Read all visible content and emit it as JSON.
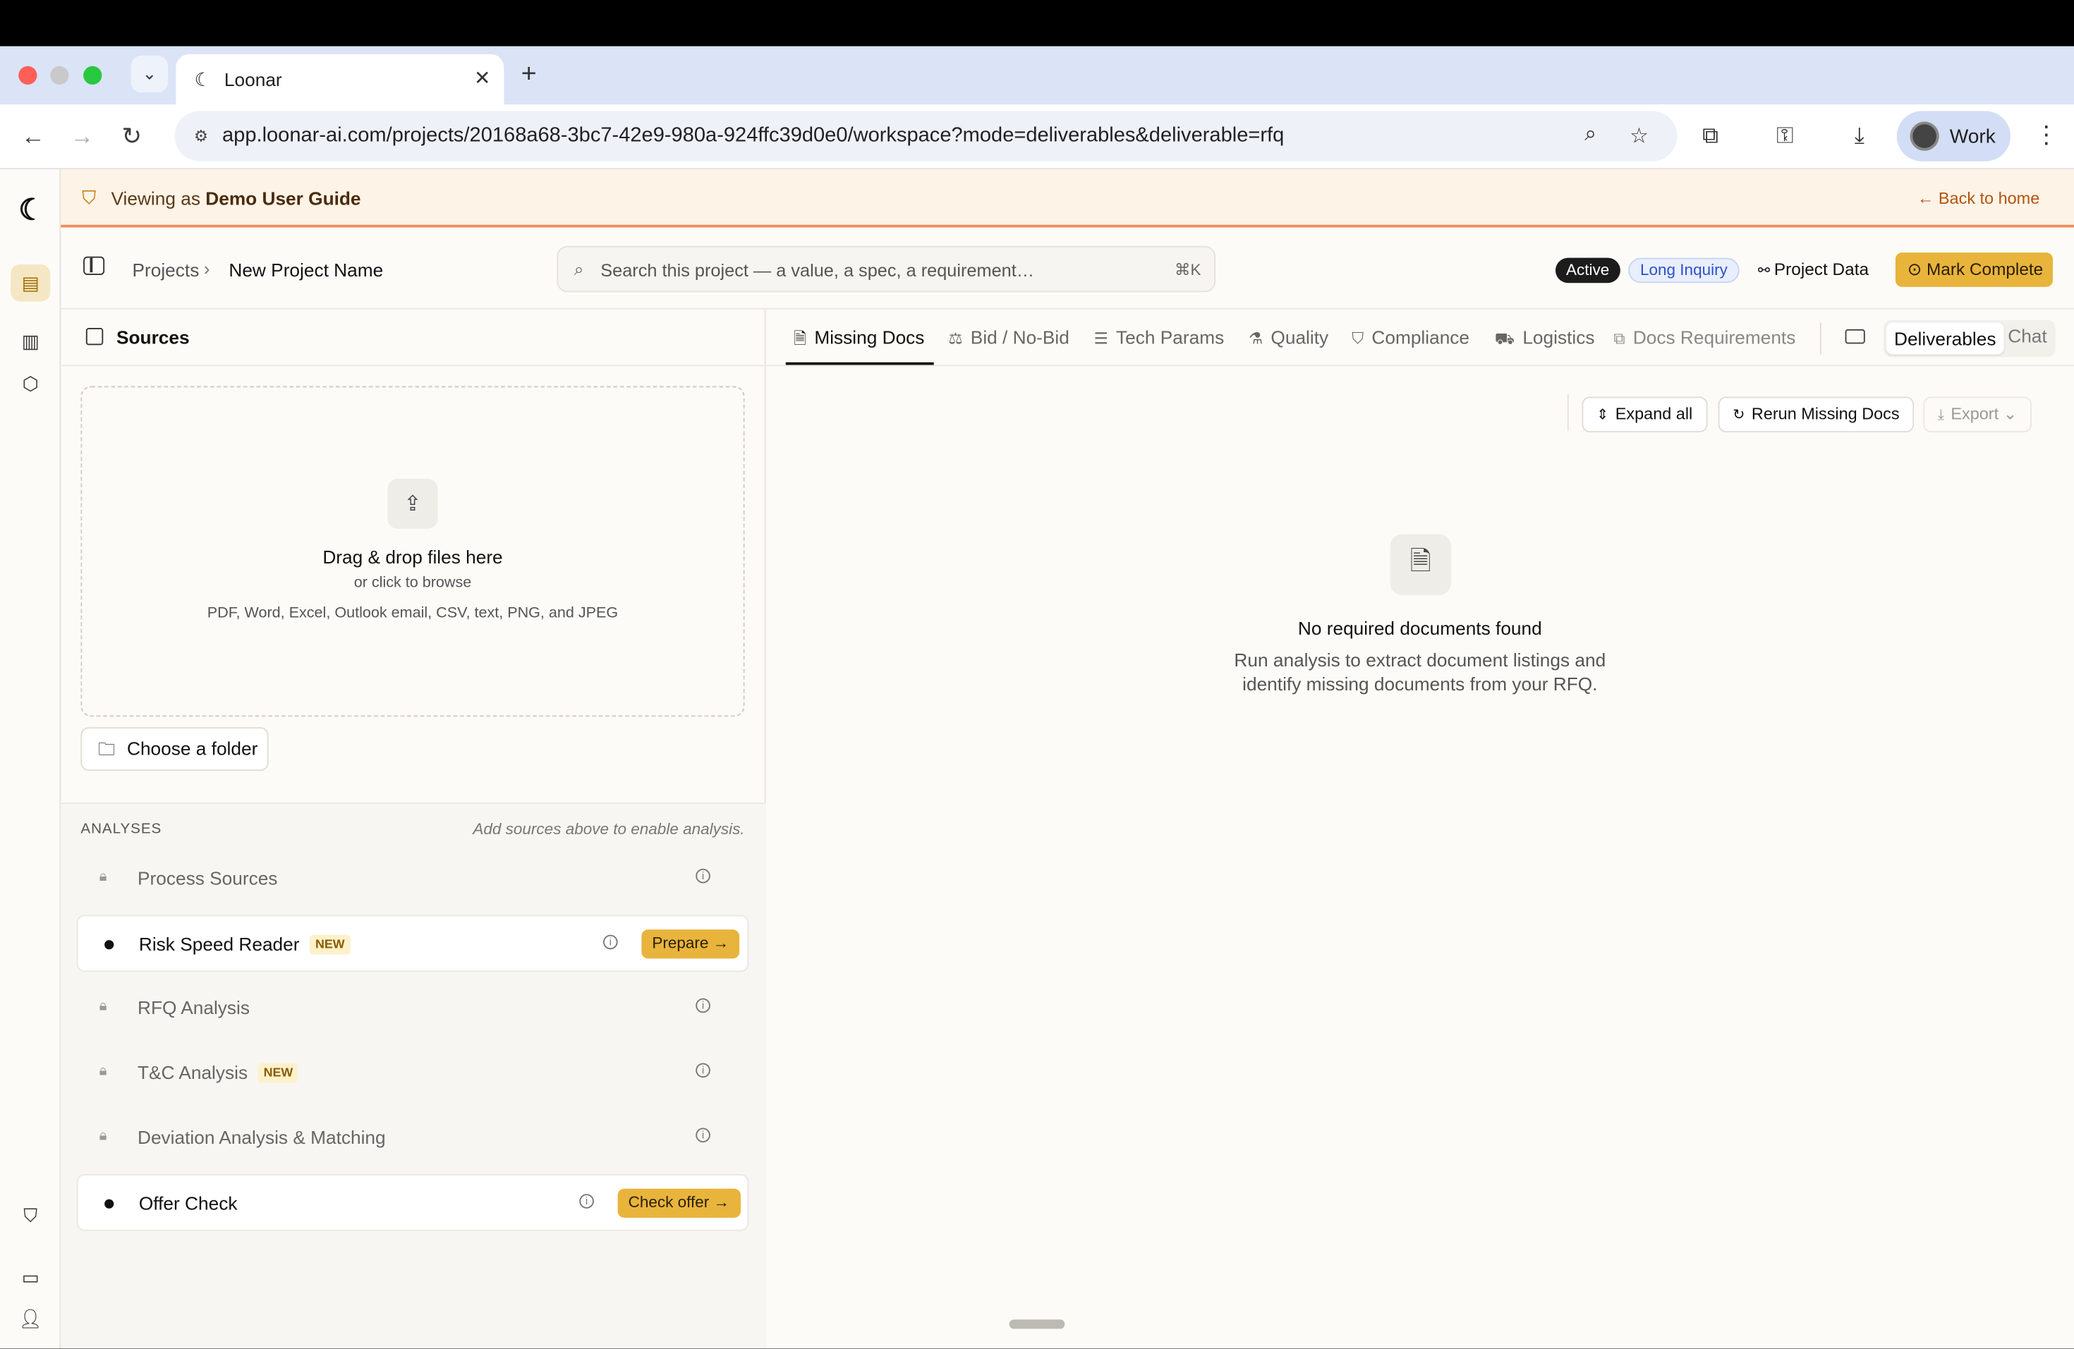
{
  "browser": {
    "tab_title": "Loonar",
    "url": "app.loonar-ai.com/projects/20168a68-3bc7-42e9-980a-924ffc39d0e0/workspace?mode=deliverables&deliverable=rfq",
    "profile_name": "Work",
    "traffic_colors": [
      "#ff5f57",
      "#c9c9c9",
      "#28c840"
    ]
  },
  "banner": {
    "prefix": "Viewing as",
    "user": "Demo User Guide",
    "back_label": "Back to home"
  },
  "header": {
    "breadcrumb_root": "Projects",
    "breadcrumb_current": "New Project Name",
    "search_placeholder": "Search this project — a value, a spec, a requirement…",
    "search_shortcut": "⌘K",
    "status_active": "Active",
    "status_type": "Long Inquiry",
    "project_data_label": "Project Data",
    "mark_complete_label": "Mark Complete"
  },
  "sources": {
    "title": "Sources",
    "drop_title": "Drag & drop files here",
    "drop_sub": "or click to browse",
    "drop_formats": "PDF, Word, Excel, Outlook email, CSV, text, PNG, and JPEG",
    "choose_folder": "Choose a folder"
  },
  "analyses": {
    "heading": "ANALYSES",
    "note": "Add sources above to enable analysis.",
    "items": [
      {
        "name": "Process Sources",
        "locked": true
      },
      {
        "name": "Risk Speed Reader",
        "badge": "NEW",
        "locked": false,
        "action": "Prepare"
      },
      {
        "name": "RFQ Analysis",
        "locked": true
      },
      {
        "name": "T&C Analysis",
        "badge": "NEW",
        "locked": true
      },
      {
        "name": "Deviation Analysis & Matching",
        "locked": true
      },
      {
        "name": "Offer Check",
        "locked": false,
        "action": "Check offer"
      }
    ]
  },
  "main": {
    "tabs": [
      "Missing Docs",
      "Bid / No-Bid",
      "Tech Params",
      "Quality",
      "Compliance",
      "Logistics",
      "Docs Requirements"
    ],
    "selected_tab": "Missing Docs",
    "mode_deliverables": "Deliverables",
    "mode_chat": "Chat",
    "expand_all": "Expand all",
    "rerun": "Rerun Missing Docs",
    "export": "Export",
    "empty_title": "No required documents found",
    "empty_desc_1": "Run analysis to extract document listings and",
    "empty_desc_2": "identify missing documents from your RFQ."
  },
  "colors": {
    "accent": "#e8b43c",
    "banner_bg": "#fdf3e6",
    "banner_border": "#f08a5d"
  },
  "icons": [
    "chevron-down-icon",
    "moon-logo-icon",
    "close-icon",
    "plus-icon",
    "back-arrow-icon",
    "forward-arrow-icon",
    "reload-icon",
    "site-settings-icon",
    "zoom-icon",
    "star-icon",
    "extensions-icon",
    "key-icon",
    "download-icon",
    "kebab-icon",
    "shield-icon",
    "arrow-left-icon",
    "folder-icon",
    "book-icon",
    "cube-icon",
    "chat-icon",
    "user-icon",
    "sidebar-toggle-icon",
    "search-icon",
    "upload-icon",
    "lock-icon",
    "info-icon",
    "arrow-right-icon",
    "file-search-icon",
    "scale-icon",
    "sliders-icon",
    "flask-icon",
    "badge-check-icon",
    "truck-icon",
    "copy-icon",
    "keyboard-icon",
    "chevrons-icon",
    "refresh-icon"
  ]
}
